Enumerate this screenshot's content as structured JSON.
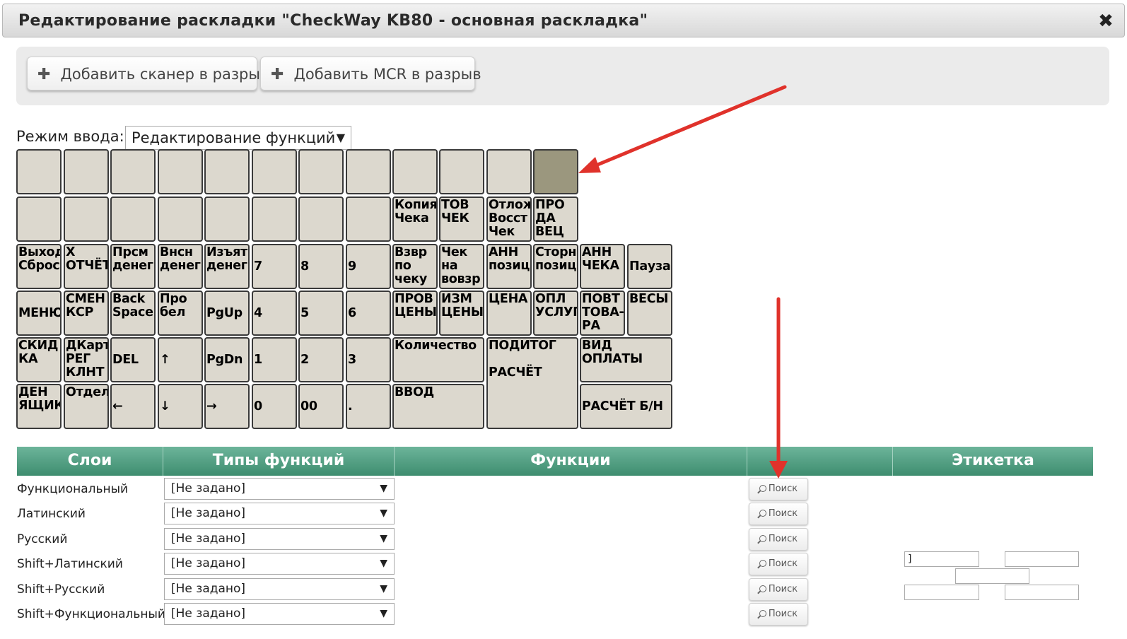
{
  "window": {
    "title": "Редактирование раскладки \"CheckWay KB80 - основная раскладка\"",
    "close_symbol": "✖"
  },
  "toolbar": {
    "add_scanner_label": "Добавить сканер в разрыв",
    "add_mcr_label": "Добавить MCR в разрыв",
    "plus": "✚"
  },
  "input_mode": {
    "label": "Режим ввода:",
    "value": "Редактирование функций",
    "arrow": "▼"
  },
  "keyboard": {
    "rows": [
      [
        "",
        "",
        "",
        "",
        "",
        "",
        "",
        "",
        "",
        "",
        "",
        ""
      ],
      [
        "",
        "",
        "",
        "",
        "",
        "",
        "",
        "",
        "Копия\nЧека",
        "ТОВ\nЧЕК",
        "Отлож\nВосст\nЧек",
        "ПРО\nДА\nВЕЦ"
      ],
      [
        "Выход\nСброс",
        "Х\nОТЧЁТ",
        "Прсм\nденег",
        "Внсн\nденег",
        "Изъят\nденег",
        "7",
        "8",
        "9",
        "Взвр\nпо\nчеку",
        "Чек\nна\nвовзр",
        "АНН\nпозиц",
        "Сторн\nпозиц",
        "АНН\nЧЕКА",
        "Пауза"
      ],
      [
        "МЕНЮ",
        "СМЕН\nКСР",
        "Back\nSpace",
        "Про\nбел",
        "PgUp",
        "4",
        "5",
        "6",
        "ПРОВ\nЦЕНЫ",
        "ИЗМ\nЦЕНЫ",
        "ЦЕНА",
        "ОПЛ\nУСЛУГ",
        "ПОВТ\nТОВА-\nРА",
        "ВЕСЫ"
      ],
      [
        "СКИД\nКА",
        "ДКарт\nРЕГ\nКЛНТ",
        "DEL",
        "↑",
        "PgDn",
        "1",
        "2",
        "3",
        "Количество",
        "ПОДИТОГ\n\nРАСЧЁТ",
        "ВИД\nОПЛАТЫ"
      ],
      [
        "ДЕН\nЯЩИК",
        "Отдел",
        "←",
        "↓",
        "→",
        "0",
        "00",
        ".",
        "ВВОД",
        "РАСЧЁТ Б/Н"
      ]
    ]
  },
  "table": {
    "headers": [
      "Слои",
      "Типы функций",
      "Функции",
      "",
      "Этикетка"
    ],
    "rows": [
      {
        "layer": "Функциональный",
        "type": "[Не задано]",
        "search": "Поиск"
      },
      {
        "layer": "Латинский",
        "type": "[Не задано]",
        "search": "Поиск"
      },
      {
        "layer": "Русский",
        "type": "[Не задано]",
        "search": "Поиск"
      },
      {
        "layer": "Shift+Латинский",
        "type": "[Не задано]",
        "search": "Поиск"
      },
      {
        "layer": "Shift+Русский",
        "type": "[Не задано]",
        "search": "Поиск"
      },
      {
        "layer": "Shift+Функциональный",
        "type": "[Не задано]",
        "search": "Поиск"
      }
    ],
    "select_arrow": "▼",
    "label_inputs": [
      "]",
      "",
      "",
      "",
      ""
    ]
  },
  "colors": {
    "header_green": "#3e8d6f",
    "key_bg": "#dcd8ce",
    "key_selected": "#9b977e",
    "arrow_red": "#e0322b"
  }
}
